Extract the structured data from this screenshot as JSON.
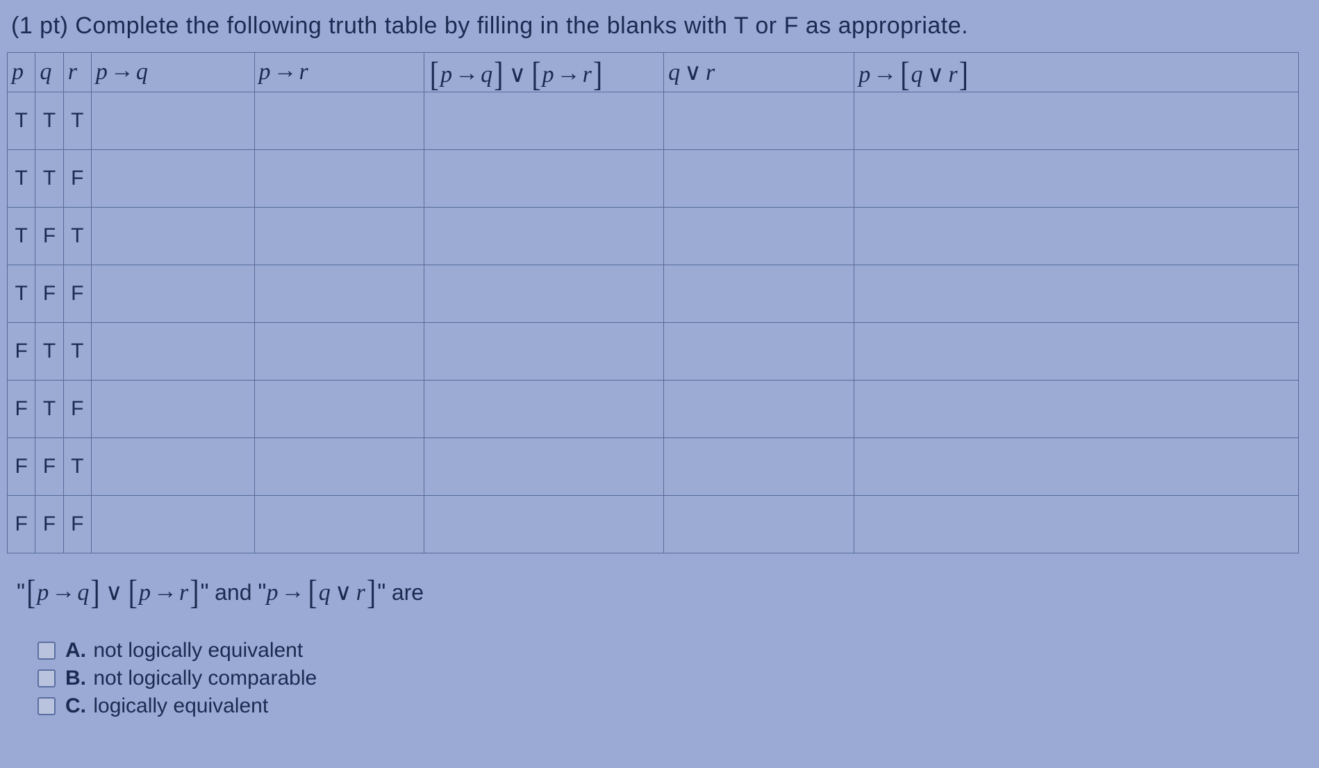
{
  "question": {
    "prompt": "(1 pt) Complete the following truth table by filling in the blanks with T or F as appropriate."
  },
  "headers": {
    "p": "p",
    "q": "q",
    "r": "r",
    "p_imp_q": "p → q",
    "p_imp_r": "p → r",
    "disj": "[p → q] ∨ [p → r]",
    "q_or_r": "q ∨ r",
    "p_imp_qr": "p → [q ∨ r]"
  },
  "rows": [
    {
      "p": "T",
      "q": "T",
      "r": "T",
      "p_imp_q": "",
      "p_imp_r": "",
      "disj": "",
      "q_or_r": "",
      "p_imp_qr": ""
    },
    {
      "p": "T",
      "q": "T",
      "r": "F",
      "p_imp_q": "",
      "p_imp_r": "",
      "disj": "",
      "q_or_r": "",
      "p_imp_qr": ""
    },
    {
      "p": "T",
      "q": "F",
      "r": "T",
      "p_imp_q": "",
      "p_imp_r": "",
      "disj": "",
      "q_or_r": "",
      "p_imp_qr": ""
    },
    {
      "p": "T",
      "q": "F",
      "r": "F",
      "p_imp_q": "",
      "p_imp_r": "",
      "disj": "",
      "q_or_r": "",
      "p_imp_qr": ""
    },
    {
      "p": "F",
      "q": "T",
      "r": "T",
      "p_imp_q": "",
      "p_imp_r": "",
      "disj": "",
      "q_or_r": "",
      "p_imp_qr": ""
    },
    {
      "p": "F",
      "q": "T",
      "r": "F",
      "p_imp_q": "",
      "p_imp_r": "",
      "disj": "",
      "q_or_r": "",
      "p_imp_qr": ""
    },
    {
      "p": "F",
      "q": "F",
      "r": "T",
      "p_imp_q": "",
      "p_imp_r": "",
      "disj": "",
      "q_or_r": "",
      "p_imp_qr": ""
    },
    {
      "p": "F",
      "q": "F",
      "r": "F",
      "p_imp_q": "",
      "p_imp_r": "",
      "disj": "",
      "q_or_r": "",
      "p_imp_qr": ""
    }
  ],
  "conclusion": {
    "expr1": "\"[p → q] ∨ [p → r]\"",
    "and": " and ",
    "expr2": "\"p → [q ∨ r]\"",
    "are": " are"
  },
  "options": [
    {
      "letter": "A.",
      "text": "not logically equivalent"
    },
    {
      "letter": "B.",
      "text": "not logically comparable"
    },
    {
      "letter": "C.",
      "text": "logically equivalent"
    }
  ]
}
